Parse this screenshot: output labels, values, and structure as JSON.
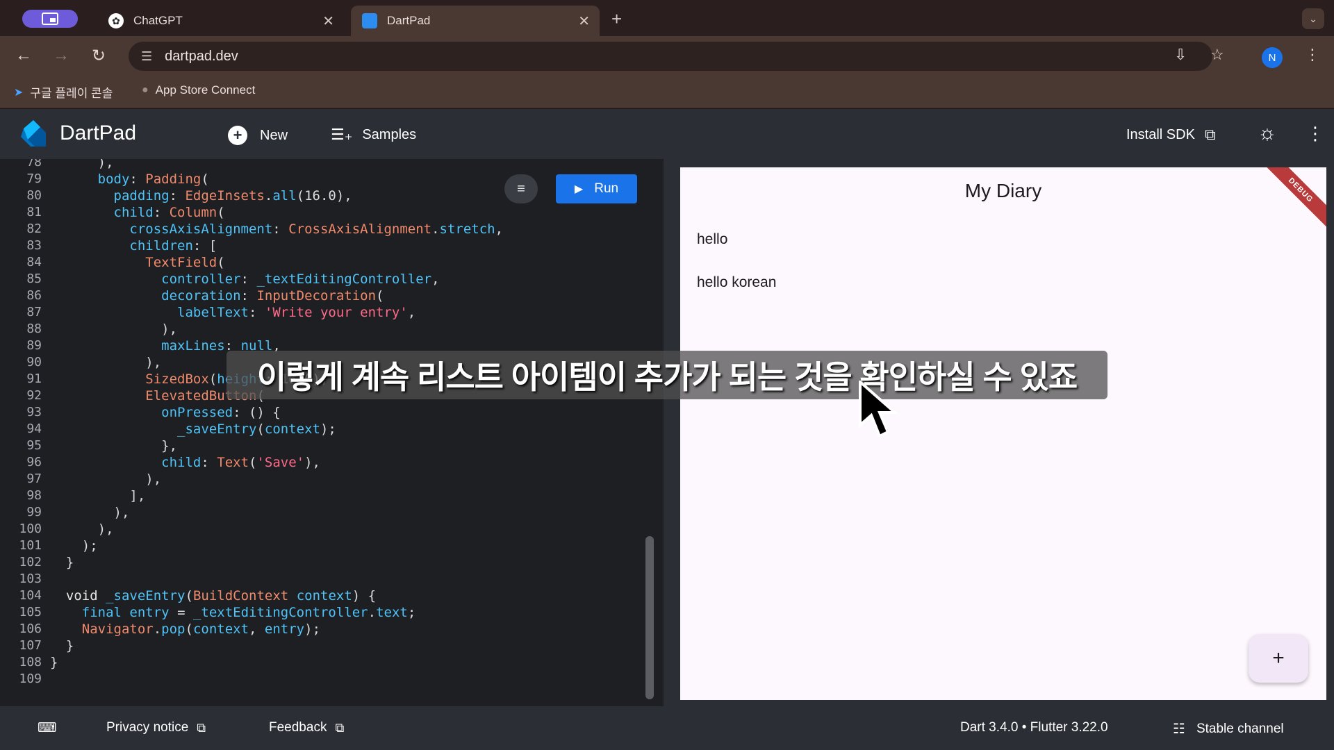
{
  "browser": {
    "tabs": [
      {
        "title": "ChatGPT",
        "icon": "chatgpt-icon",
        "active": false
      },
      {
        "title": "DartPad",
        "icon": "dartpad-icon",
        "active": true
      }
    ],
    "url": "dartpad.dev",
    "profile_initial": "N",
    "bookmarks": [
      {
        "label": "구글 플레이 콘솔",
        "icon": "play-console-icon"
      },
      {
        "label": "App Store Connect",
        "icon": "apple-icon"
      }
    ]
  },
  "dartpad": {
    "brand": "DartPad",
    "new_label": "New",
    "samples_label": "Samples",
    "install_sdk_label": "Install SDK",
    "run_label": "Run"
  },
  "editor": {
    "line_numbers": [
      "78",
      "79",
      "80",
      "81",
      "82",
      "83",
      "84",
      "85",
      "86",
      "87",
      "88",
      "89",
      "90",
      "91",
      "92",
      "93",
      "94",
      "95",
      "96",
      "97",
      "98",
      "99",
      "100",
      "101",
      "102",
      "103",
      "104",
      "105",
      "106",
      "107",
      "108",
      "109"
    ]
  },
  "preview": {
    "title": "My Diary",
    "entries": [
      "hello",
      "hello korean"
    ],
    "debug_banner": "DEBUG",
    "fab_label": "+"
  },
  "footer": {
    "privacy": "Privacy notice",
    "feedback": "Feedback",
    "version": "Dart 3.4.0 • Flutter 3.22.0",
    "channel": "Stable channel"
  },
  "caption": "이렇게 계속 리스트 아이템이 추가가 되는 것을 확인하실 수 있죠",
  "colors": {
    "accent": "#1a73e8",
    "editor_bg": "#1e1f22",
    "preview_bg": "#fdf8fd",
    "debug_banner": "#b83a3a"
  }
}
